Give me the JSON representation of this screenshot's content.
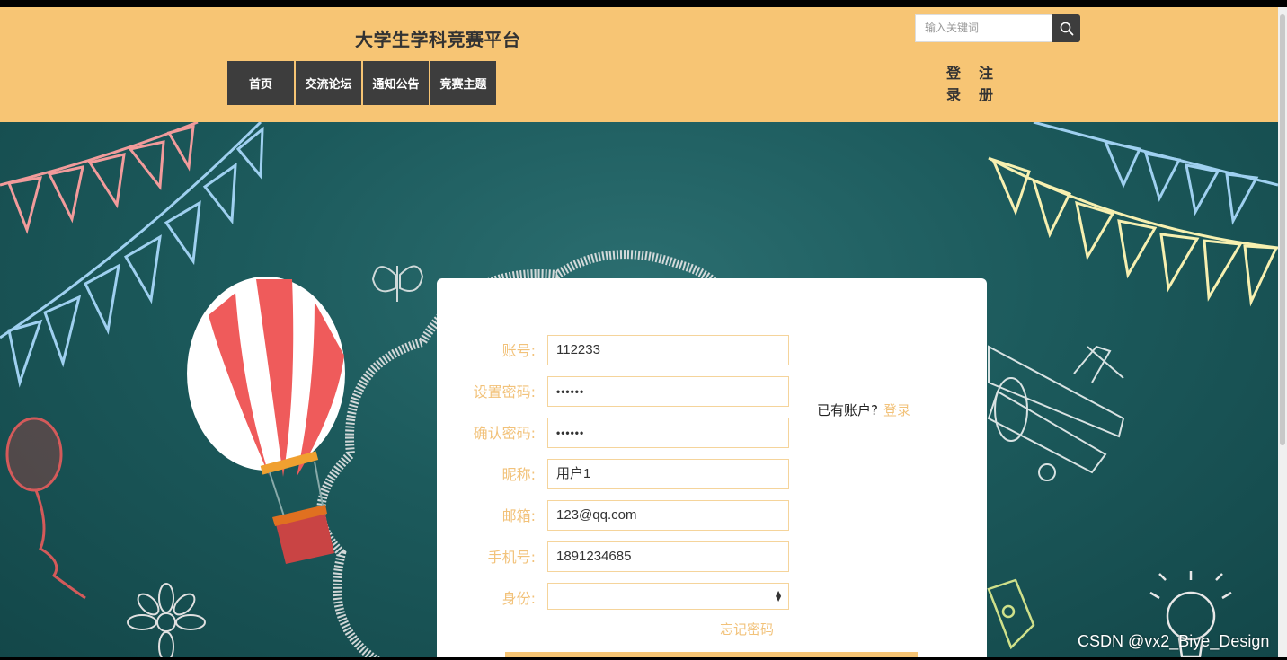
{
  "header": {
    "site_title": "大学生学科竞赛平台",
    "nav": [
      "首页",
      "交流论坛",
      "通知公告",
      "竞赛主题"
    ],
    "search_placeholder": "输入关键词",
    "login_chars": [
      "登",
      "录"
    ],
    "register_chars": [
      "注",
      "册"
    ]
  },
  "form": {
    "fields": [
      {
        "label": "账号:",
        "value": "112233"
      },
      {
        "label": "设置密码:",
        "value": "••••••"
      },
      {
        "label": "确认密码:",
        "value": "••••••"
      },
      {
        "label": "昵称:",
        "value": "用户1"
      },
      {
        "label": "邮箱:",
        "value": "123@qq.com"
      },
      {
        "label": "手机号:",
        "value": "1891234685"
      }
    ],
    "role_label": "身份:",
    "role_value": "",
    "have_account": "已有账户?",
    "login_link": "登录",
    "forgot_password": "忘记密码"
  },
  "watermark": "CSDN @vx2_Biye_Design",
  "colors": {
    "header_bg": "#f7c574",
    "nav_bg": "#3d3d3d",
    "accent": "#f2c27a",
    "board_bg": "#1c5a5c"
  }
}
